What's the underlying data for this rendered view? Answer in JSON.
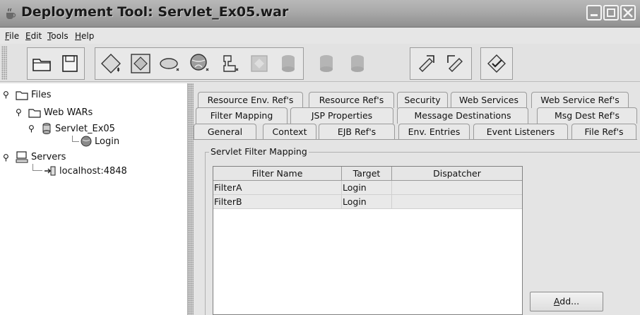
{
  "window": {
    "title": "Deployment Tool: Servlet_Ex05.war"
  },
  "menu": {
    "items": [
      {
        "mnemonic": "F",
        "rest": "ile"
      },
      {
        "mnemonic": "E",
        "rest": "dit"
      },
      {
        "mnemonic": "T",
        "rest": "ools"
      },
      {
        "mnemonic": "H",
        "rest": "elp"
      }
    ]
  },
  "tree": {
    "files": "Files",
    "web_wars": "Web WARs",
    "servlet": "Servlet_Ex05",
    "login": "Login",
    "servers": "Servers",
    "localhost": "localhost:4848"
  },
  "tabs": {
    "row1": [
      "Resource Env. Ref's",
      "Resource Ref's",
      "Security",
      "Web Services",
      "Web Service Ref's"
    ],
    "row2": [
      "Filter Mapping",
      "JSP Properties",
      "Message Destinations",
      "Msg Dest Ref's"
    ],
    "row3": [
      "General",
      "Context",
      "EJB Ref's",
      "Env. Entries",
      "Event Listeners",
      "File Ref's"
    ]
  },
  "filter_mapping": {
    "panel_title": "Servlet Filter Mapping",
    "columns": [
      "Filter Name",
      "Target",
      "Dispatcher"
    ],
    "rows": [
      {
        "filter": "FilterA",
        "target": "Login",
        "dispatcher": ""
      },
      {
        "filter": "FilterB",
        "target": "Login",
        "dispatcher": ""
      }
    ],
    "add_button": {
      "mnemonic": "A",
      "rest": "dd..."
    }
  },
  "colors": {
    "titlebar": "#a9a9a9",
    "background": "#e4e4e4",
    "tree_background": "#ffffff"
  }
}
